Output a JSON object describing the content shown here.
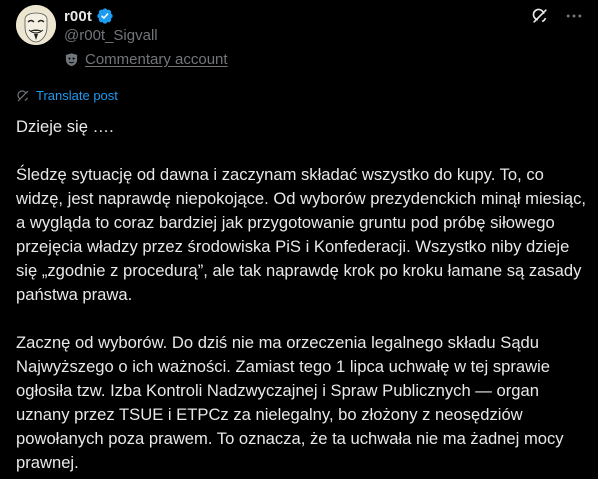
{
  "author": {
    "display_name": "r00t",
    "handle": "@r00t_Sigvall",
    "account_label": "Commentary account"
  },
  "actions": {
    "grok_icon": "grok-icon",
    "more_icon": "more-options-icon"
  },
  "translate": {
    "label": "Translate post"
  },
  "post": {
    "paragraphs": [
      "Dzieje się ….",
      "Śledzę sytuację od dawna i zaczynam składać wszystko do kupy. To, co widzę, jest naprawdę niepokojące. Od wyborów prezydenckich minął miesiąc, a wygląda to coraz bardziej jak przygotowanie gruntu pod próbę siłowego przejęcia władzy przez środowiska PiS i Konfederacji. Wszystko niby dzieje się „zgodnie z procedurą”, ale tak naprawdę krok po kroku łamane są zasady państwa prawa.",
      "Zacznę od wyborów. Do dziś nie ma orzeczenia legalnego składu Sądu Najwyższego o ich ważności. Zamiast tego 1 lipca uchwałę w tej sprawie ogłosiła tzw. Izba Kontroli Nadzwyczajnej i Spraw Publicznych — organ uznany przez TSUE i ETPCz za nielegalny, bo złożony z neosędziów powołanych poza prawem. To oznacza, że ta uchwała nie ma żadnej mocy prawnej."
    ]
  },
  "colors": {
    "background": "#000000",
    "text_primary": "#e7e9ea",
    "text_secondary": "#71767b",
    "accent": "#1d9bf0"
  }
}
